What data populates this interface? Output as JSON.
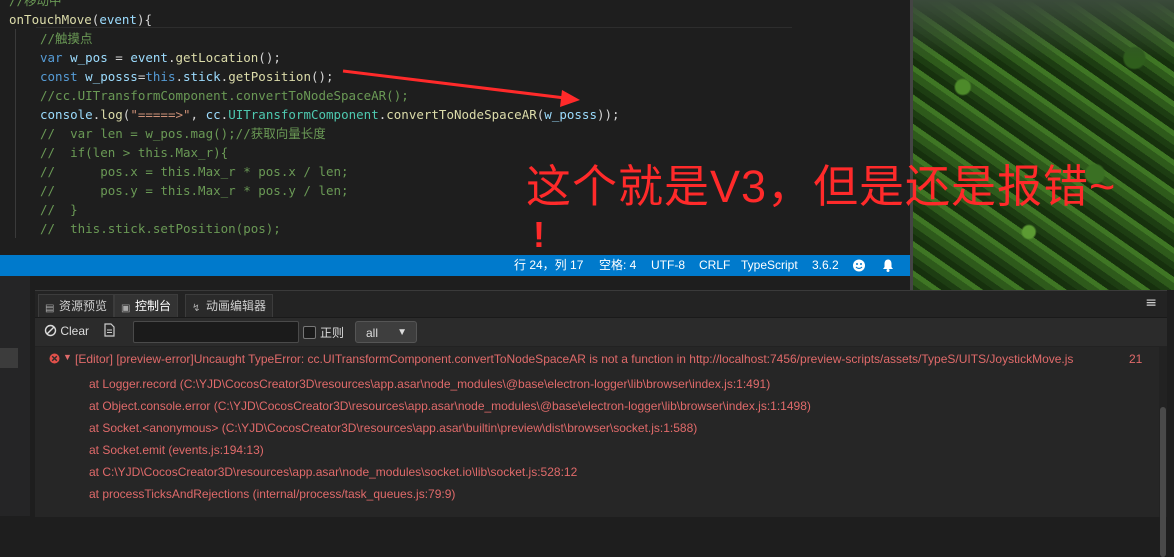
{
  "editor": {
    "lines": [
      {
        "indent": 0,
        "tokens": [
          [
            "cm",
            "//移动中"
          ]
        ]
      },
      {
        "indent": 0,
        "tokens": [
          [
            "fn",
            "onTouchMove"
          ],
          [
            "",
            "("
          ],
          [
            "vr",
            "event"
          ],
          [
            "",
            "){"
          ]
        ]
      },
      {
        "indent": 1,
        "tokens": [
          [
            "cm",
            "//触摸点"
          ]
        ]
      },
      {
        "indent": 1,
        "tokens": [
          [
            "kw",
            "var "
          ],
          [
            "vr",
            "w_pos"
          ],
          [
            "",
            " = "
          ],
          [
            "vr",
            "event"
          ],
          [
            "",
            "."
          ],
          [
            "fn",
            "getLocation"
          ],
          [
            "",
            "();"
          ]
        ]
      },
      {
        "indent": 1,
        "tokens": [
          [
            "kw",
            "const "
          ],
          [
            "vr",
            "w_posss"
          ],
          [
            "",
            "="
          ],
          [
            "kw",
            "this"
          ],
          [
            "",
            "."
          ],
          [
            "vr",
            "stick"
          ],
          [
            "",
            "."
          ],
          [
            "fn",
            "getPosition"
          ],
          [
            "",
            "();"
          ]
        ]
      },
      {
        "indent": 1,
        "tokens": [
          [
            "cm",
            "//cc.UITransformComponent.convertToNodeSpaceAR();"
          ]
        ]
      },
      {
        "indent": 1,
        "tokens": [
          [
            "vr",
            "console"
          ],
          [
            "",
            "."
          ],
          [
            "fn",
            "log"
          ],
          [
            "",
            "("
          ],
          [
            "st",
            "\"=====>\""
          ],
          [
            "",
            ", "
          ],
          [
            "vr",
            "cc"
          ],
          [
            "",
            "."
          ],
          [
            "cs",
            "UITransformComponent"
          ],
          [
            "",
            "."
          ],
          [
            "fn",
            "convertToNodeSpaceAR"
          ],
          [
            "",
            "("
          ],
          [
            "vr",
            "w_posss"
          ],
          [
            "",
            "));"
          ]
        ]
      },
      {
        "indent": 1,
        "tokens": [
          [
            "cm",
            "//  var len = w_pos.mag();//获取向量长度"
          ]
        ]
      },
      {
        "indent": 1,
        "tokens": [
          [
            "cm",
            "//  if(len > this.Max_r){"
          ]
        ]
      },
      {
        "indent": 1,
        "tokens": [
          [
            "cm",
            "//      pos.x = this.Max_r * pos.x / len;"
          ]
        ]
      },
      {
        "indent": 1,
        "tokens": [
          [
            "cm",
            "//      pos.y = this.Max_r * pos.y / len;"
          ]
        ]
      },
      {
        "indent": 1,
        "tokens": [
          [
            "cm",
            "//  }"
          ]
        ]
      },
      {
        "indent": 1,
        "tokens": [
          [
            "cm",
            "//  this.stick.setPosition(pos);"
          ]
        ]
      }
    ]
  },
  "statusbar": {
    "position": "行 24，列 17",
    "indent": "空格: 4",
    "encoding": "UTF-8",
    "eol": "CRLF",
    "language": "TypeScript",
    "version": "3.6.2",
    "feedback_icon": "smiley-icon",
    "notifications_icon": "bell-icon"
  },
  "panel": {
    "tabs": [
      {
        "label": "资源预览",
        "icon": "file-icon"
      },
      {
        "label": "控制台",
        "icon": "terminal-icon",
        "active": true
      },
      {
        "label": "动画编辑器",
        "icon": "animation-icon"
      }
    ],
    "menu_icon": "hamburger-icon",
    "toolbar": {
      "clear_label": "Clear",
      "search_value": "",
      "regex_label": "正则",
      "level_value": "all"
    },
    "log": {
      "error_header": "[Editor] [preview-error]Uncaught TypeError: cc.UITransformComponent.convertToNodeSpaceAR is not a function in http://localhost:7456/preview-scripts/assets/TypeS/UITS/JoystickMove.js",
      "error_count": "21",
      "stack": [
        "at Logger.record (C:\\YJD\\CocosCreator3D\\resources\\app.asar\\node_modules\\@base\\electron-logger\\lib\\browser\\index.js:1:491)",
        "at Object.console.error (C:\\YJD\\CocosCreator3D\\resources\\app.asar\\node_modules\\@base\\electron-logger\\lib\\browser\\index.js:1:1498)",
        "at Socket.<anonymous> (C:\\YJD\\CocosCreator3D\\resources\\app.asar\\builtin\\preview\\dist\\browser\\socket.js:1:588)",
        "at Socket.emit (events.js:194:13)",
        "at C:\\YJD\\CocosCreator3D\\resources\\app.asar\\node_modules\\socket.io\\lib\\socket.js:528:12",
        "at processTicksAndRejections (internal/process/task_queues.js:79:9)"
      ]
    }
  },
  "annotation": {
    "text": "这个就是V3，但是还是报错~",
    "mark": "!",
    "color": "#ff2a2a"
  },
  "colors": {
    "statusbar_bg": "#007acc",
    "error_text": "#e06a6a",
    "editor_bg": "#1e1e1e"
  }
}
